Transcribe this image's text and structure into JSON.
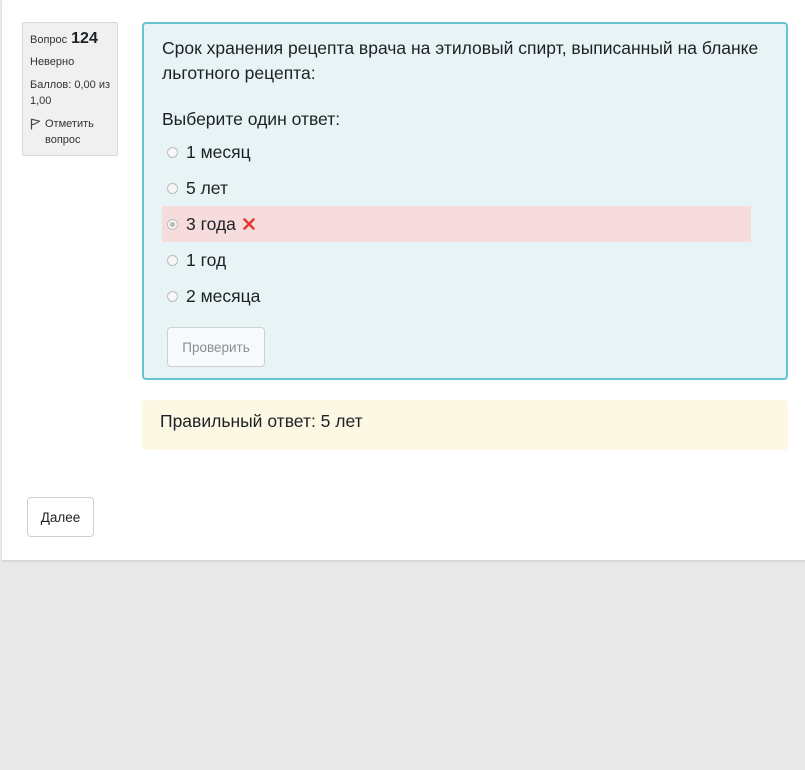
{
  "question_info": {
    "label": "Вопрос",
    "number": "124",
    "state": "Неверно",
    "grade": "Баллов: 0,00 из 1,00",
    "flag_label": "Отметить вопрос"
  },
  "question": {
    "text": "Срок хранения рецепта врача на этиловый спирт, выписанный на бланке льготного рецепта:",
    "prompt": "Выберите один ответ:",
    "answers": [
      {
        "label": "1 месяц",
        "selected": false,
        "incorrect": false
      },
      {
        "label": "5 лет",
        "selected": false,
        "incorrect": false
      },
      {
        "label": "3 года",
        "selected": true,
        "incorrect": true
      },
      {
        "label": "1 год",
        "selected": false,
        "incorrect": false
      },
      {
        "label": "2 месяца",
        "selected": false,
        "incorrect": false
      }
    ],
    "check_button": "Проверить"
  },
  "feedback": {
    "text": "Правильный ответ: 5 лет"
  },
  "nav": {
    "next_button": "Далее"
  },
  "colors": {
    "question_bg": "#e7f3f5",
    "question_border": "#66c4d1",
    "incorrect_bg": "#f6dcdc",
    "incorrect_mark": "#e53935",
    "feedback_bg": "#fcf8e3"
  },
  "icons": {
    "flag": "flag-icon",
    "incorrect": "cross-icon"
  }
}
